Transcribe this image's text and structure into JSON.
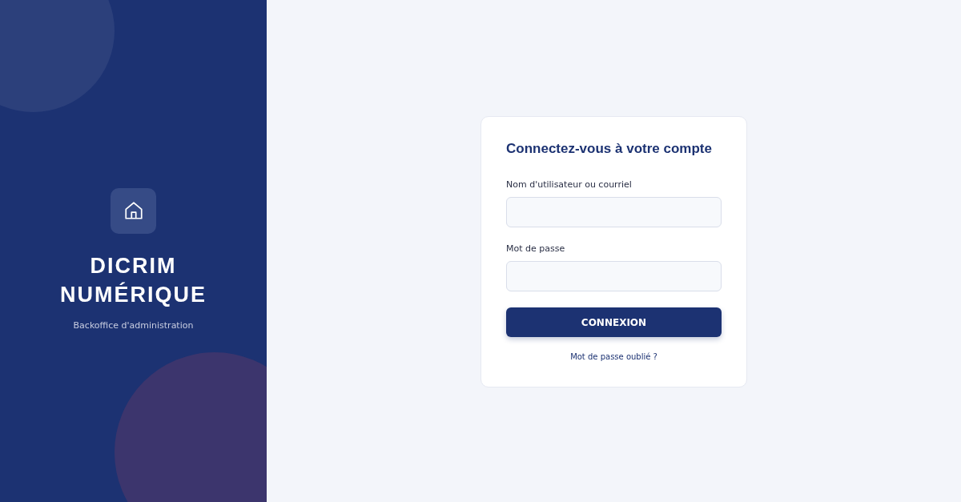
{
  "brand": {
    "title_lines": [
      "DICRIM",
      "NUMÉRIQUE"
    ],
    "subtitle": "Backoffice d'administration"
  },
  "login": {
    "heading": "Connectez-vous à votre compte",
    "fields": [
      {
        "label": "Nom d'utilisateur ou courriel"
      },
      {
        "label": "Mot de passe"
      }
    ],
    "submit": "CONNEXION",
    "forgot_link": "Mot de passe oublié ?"
  }
}
